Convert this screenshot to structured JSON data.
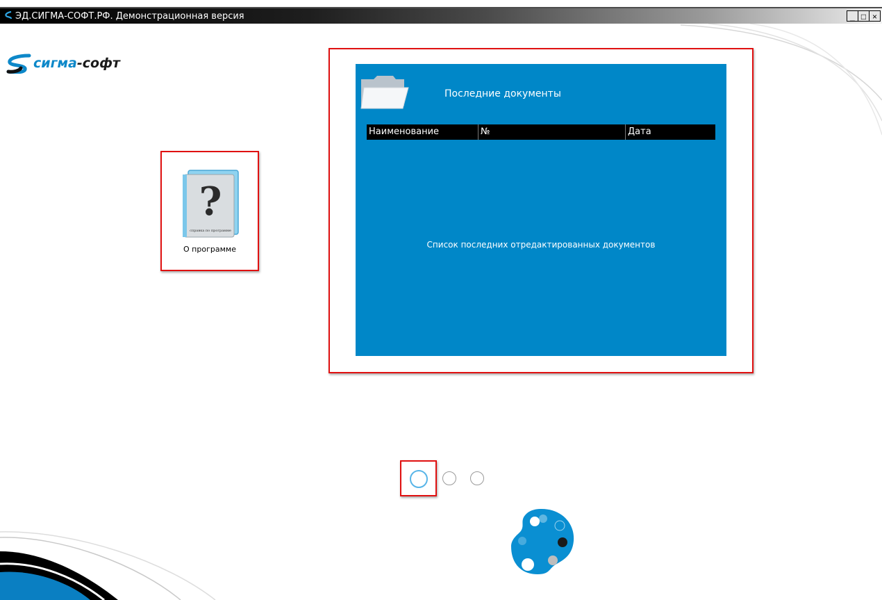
{
  "window": {
    "title": "ЭД.СИГМА-СОФТ.РФ. Демонстрационная версия",
    "controls": [
      "_",
      "□",
      "×"
    ]
  },
  "logo": {
    "text_main": "сигма",
    "text_dash": "-",
    "text_tail": "софт"
  },
  "about_tile": {
    "label": "О программе",
    "book_caption": "справка по программе",
    "icon": "help-book-icon"
  },
  "recent_docs": {
    "title": "Последние документы",
    "columns": [
      "Наименование",
      "№",
      "Дата"
    ],
    "empty_text": "Список последних отредактированных документов",
    "icon": "folder-icon"
  },
  "pager": {
    "pages": 3,
    "active": 1
  },
  "palette": {
    "icon": "palette-icon"
  },
  "colors": {
    "accent_blue": "#0087c8",
    "highlight_red": "#e01010",
    "logo_blue": "#0d88c9"
  }
}
